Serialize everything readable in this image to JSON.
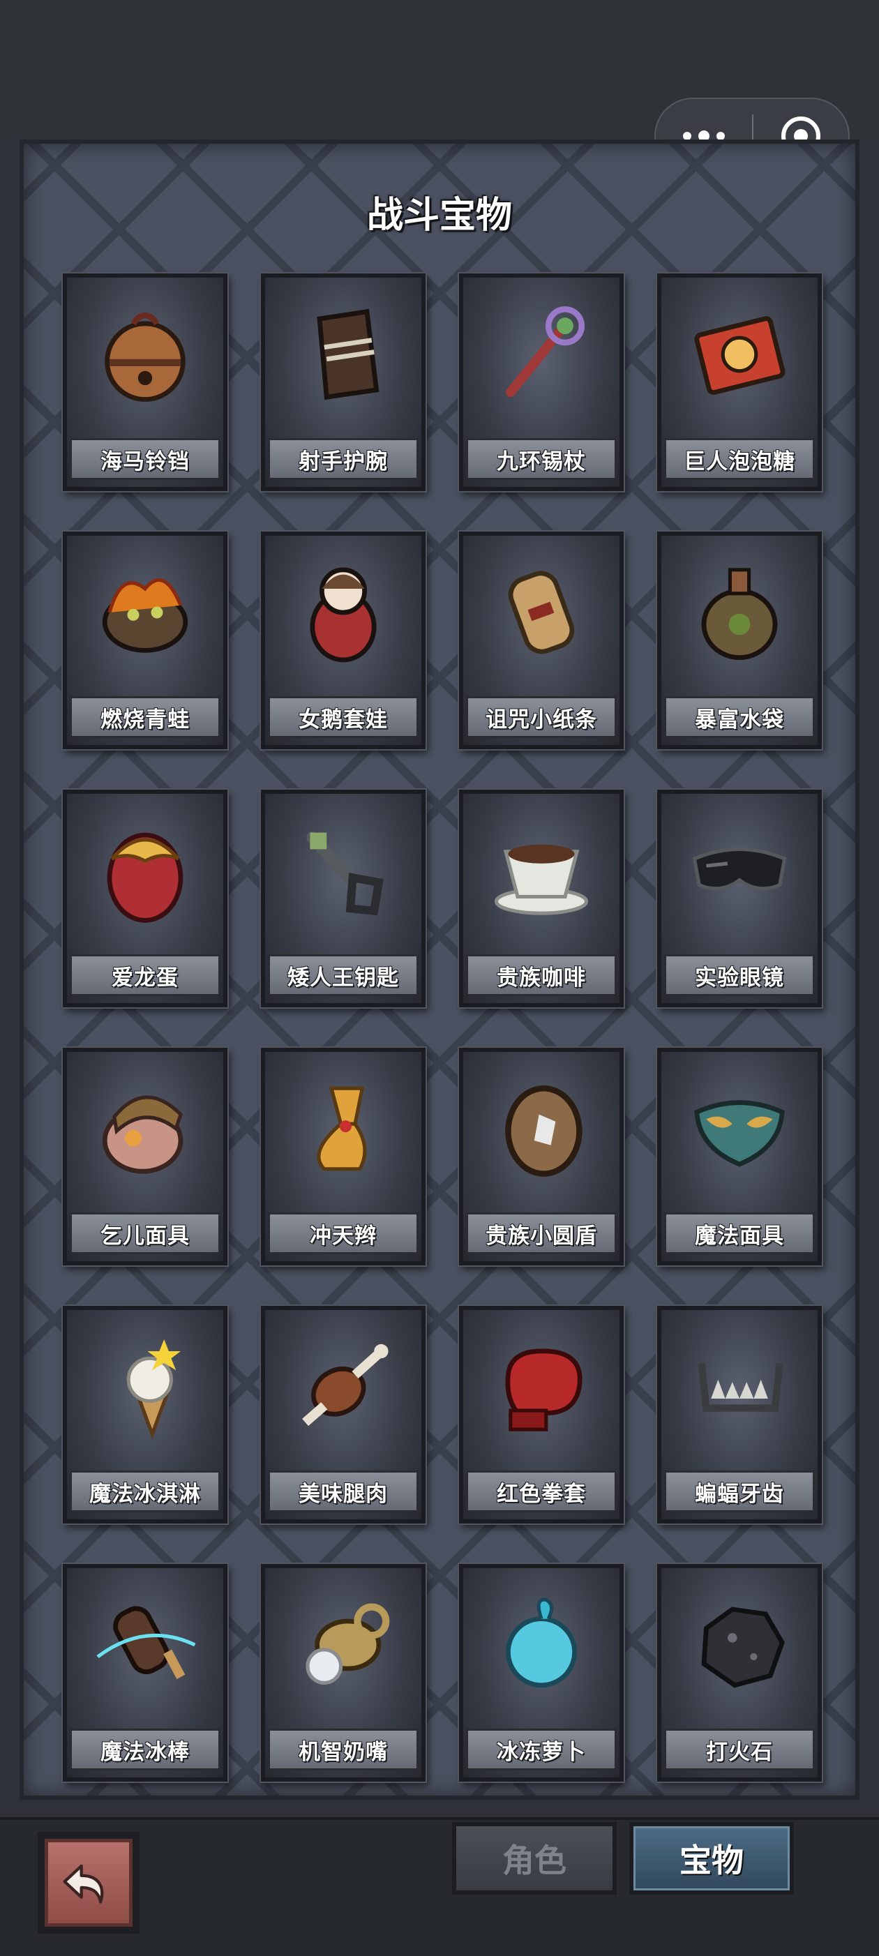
{
  "window": {
    "capsule": {
      "more_icon": "more-dots-icon",
      "close_icon": "target-circle-icon"
    }
  },
  "panel": {
    "title": "战斗宝物",
    "items": [
      {
        "name": "海马铃铛",
        "icon": "bell-icon",
        "color": "#a8683a"
      },
      {
        "name": "射手护腕",
        "icon": "wrist-guard-icon",
        "color": "#4a3428"
      },
      {
        "name": "九环锡杖",
        "icon": "staff-icon",
        "color": "#a03838"
      },
      {
        "name": "巨人泡泡糖",
        "icon": "gum-pack-icon",
        "color": "#c8402e"
      },
      {
        "name": "燃烧青蛙",
        "icon": "burning-frog-icon",
        "color": "#e07a1e"
      },
      {
        "name": "女鹅套娃",
        "icon": "matryoshka-icon",
        "color": "#a83232"
      },
      {
        "name": "诅咒小纸条",
        "icon": "scroll-icon",
        "color": "#c8a06a"
      },
      {
        "name": "暴富水袋",
        "icon": "water-bag-icon",
        "color": "#6b5a3a"
      },
      {
        "name": "爱龙蛋",
        "icon": "dragon-egg-icon",
        "color": "#b02f35"
      },
      {
        "name": "矮人王钥匙",
        "icon": "key-icon",
        "color": "#555a5e"
      },
      {
        "name": "贵族咖啡",
        "icon": "coffee-cup-icon",
        "color": "#e4e6e0"
      },
      {
        "name": "实验眼镜",
        "icon": "goggles-icon",
        "color": "#1d1f22"
      },
      {
        "name": "乞儿面具",
        "icon": "beggar-mask-icon",
        "color": "#c89486"
      },
      {
        "name": "冲天辫",
        "icon": "pigtail-icon",
        "color": "#e0a23a"
      },
      {
        "name": "贵族小圆盾",
        "icon": "round-shield-icon",
        "color": "#8c6a48"
      },
      {
        "name": "魔法面具",
        "icon": "magic-mask-icon",
        "color": "#3f7a78"
      },
      {
        "name": "魔法冰淇淋",
        "icon": "ice-cream-icon",
        "color": "#f0eee4"
      },
      {
        "name": "美味腿肉",
        "icon": "drumstick-icon",
        "color": "#8a4a2c"
      },
      {
        "name": "红色拳套",
        "icon": "boxing-glove-icon",
        "color": "#b82a2a"
      },
      {
        "name": "蝙蝠牙齿",
        "icon": "bat-teeth-icon",
        "color": "#3a3c40"
      },
      {
        "name": "魔法冰棒",
        "icon": "popsicle-icon",
        "color": "#5a3a2a"
      },
      {
        "name": "机智奶嘴",
        "icon": "pacifier-icon",
        "color": "#b89a5a"
      },
      {
        "name": "冰冻萝卜",
        "icon": "frozen-radish-icon",
        "color": "#56c8e0"
      },
      {
        "name": "打火石",
        "icon": "flint-stone-icon",
        "color": "#2e3034"
      }
    ]
  },
  "bottom": {
    "back_icon": "return-arrow-icon",
    "tabs": [
      {
        "label": "角色",
        "active": false
      },
      {
        "label": "宝物",
        "active": true
      }
    ]
  }
}
